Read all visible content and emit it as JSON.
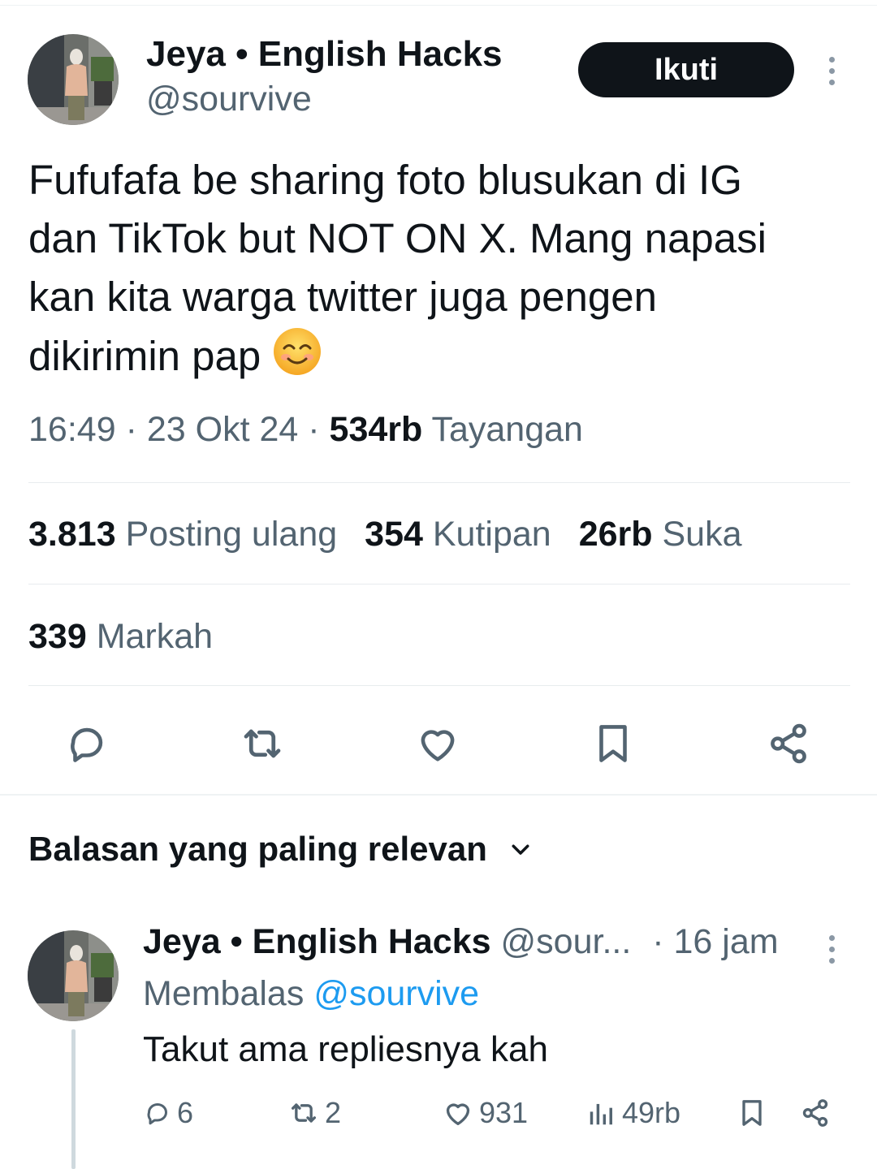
{
  "tweet": {
    "author_name": "Jeya • English Hacks",
    "author_handle": "@sourvive",
    "follow_label": "Ikuti",
    "text": "Fufufafa be sharing foto blusukan di IG dan TikTok but NOT ON X. Mang napasi kan kita warga twitter juga pengen dikirimin pap",
    "text_lines": [
      "Fufufafa be sharing foto blusukan di IG",
      "dan TikTok but NOT ON X. Mang napasi",
      "kan kita warga twitter juga pengen",
      "dikirimin pap"
    ],
    "time": "16:49",
    "date": "23 Okt 24",
    "separator": "·",
    "views_count": "534rb",
    "views_label": "Tayangan",
    "stats": {
      "reposts_count": "3.813",
      "reposts_label": "Posting ulang",
      "quotes_count": "354",
      "quotes_label": "Kutipan",
      "likes_count": "26rb",
      "likes_label": "Suka",
      "bookmarks_count": "339",
      "bookmarks_label": "Markah"
    },
    "actions": [
      "reply-icon",
      "repost-icon",
      "like-icon",
      "bookmark-icon",
      "share-icon"
    ]
  },
  "replies_section": {
    "sort_label": "Balasan yang paling relevan"
  },
  "reply": {
    "author_name": "Jeya • English Hacks",
    "author_handle": "@sour...",
    "time": "· 16 jam",
    "replying_label": "Membalas",
    "replying_to": "@sourvive",
    "text": "Takut ama repliesnya kah",
    "reply_count": "6",
    "repost_count": "2",
    "like_count": "931",
    "view_count": "49rb"
  },
  "colors": {
    "text": "#0f1419",
    "muted": "#536471",
    "link": "#1d9bf0",
    "button_bg": "#0f1419",
    "divider": "#e8ecee"
  }
}
